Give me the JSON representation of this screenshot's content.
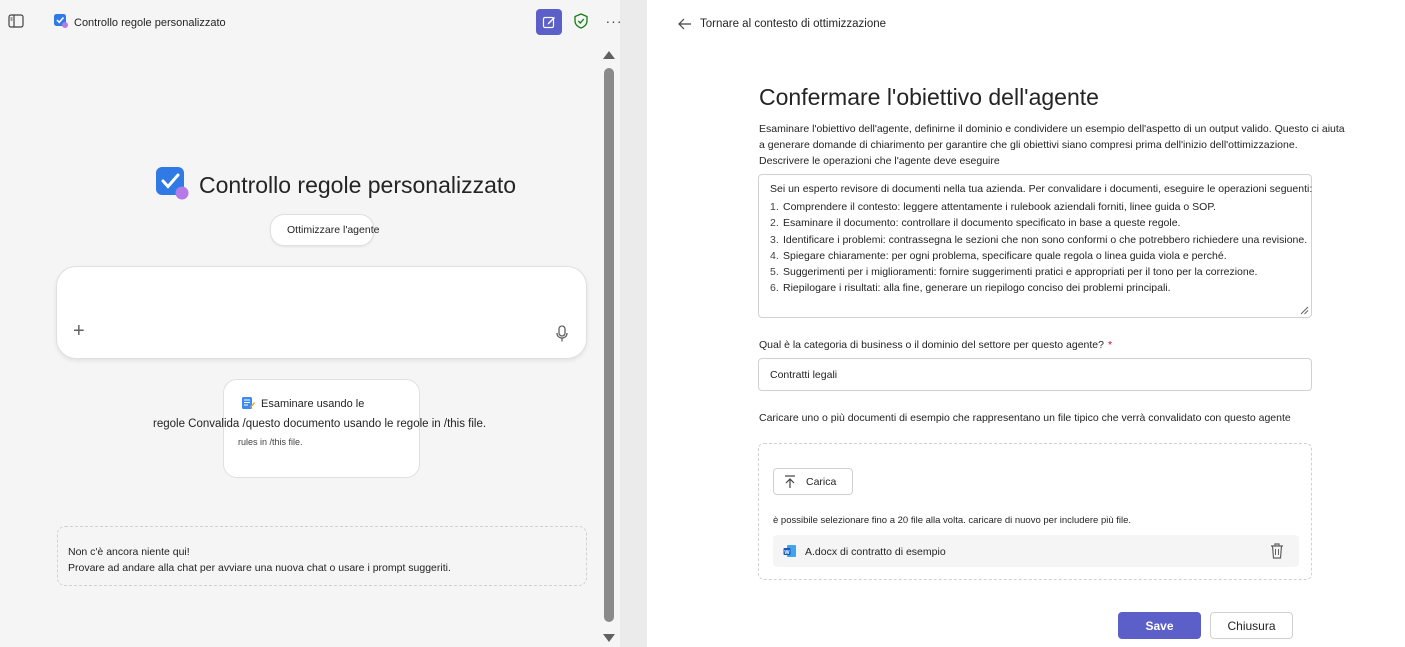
{
  "header": {
    "app_title": "Controllo regole personalizzato"
  },
  "hero": {
    "title": "Controllo regole personalizzato",
    "optimize_label": "Ottimizzare l'agente"
  },
  "prompt_card": {
    "title": "Esaminare usando le",
    "overflow_text": "regole Convalida /questo documento usando le regole in /this file.",
    "sub_text": "rules in /this file."
  },
  "empty_state": {
    "line1": "Non c'è ancora niente qui!",
    "line2": "Provare ad andare alla chat per avviare una nuova chat o usare i prompt suggeriti."
  },
  "right_panel": {
    "back_label": "Tornare al contesto di ottimizzazione",
    "title": "Confermare l'obiettivo dell'agente",
    "description": "Esaminare l'obiettivo dell'agente, definirne il dominio e condividere un esempio dell'aspetto di un output valido. Questo ci aiuta a generare domande di chiarimento per garantire che gli obiettivi siano compresi prima dell'inizio dell'ottimizzazione.",
    "instructions_label": "Descrivere le operazioni che l'agente deve eseguire",
    "instructions": {
      "intro": "Sei un esperto revisore di documenti nella tua azienda. Per convalidare i documenti, eseguire le operazioni seguenti:",
      "steps": [
        {
          "num": "1.",
          "text": "Comprendere il contesto: leggere attentamente i rulebook aziendali forniti, linee guida o SOP."
        },
        {
          "num": "2.",
          "text": "Esaminare il documento: controllare il documento specificato in base a queste regole."
        },
        {
          "num": "3.",
          "text": "Identificare i problemi: contrassegna le sezioni che non sono conformi o che potrebbero richiedere una revisione."
        },
        {
          "num": "4.",
          "text": "Spiegare chiaramente: per ogni problema, specificare quale regola o linea guida viola e perché."
        },
        {
          "num": "5.",
          "text": "Suggerimenti per i miglioramenti: fornire suggerimenti pratici e appropriati per il tono per la correzione."
        },
        {
          "num": "6.",
          "text": "Riepilogare i risultati: alla fine, generare un riepilogo conciso dei problemi principali."
        }
      ]
    },
    "domain_label": "Qual è la categoria di business o il dominio del settore per questo agente?",
    "domain_required": "*",
    "domain_value": "Contratti legali",
    "upload_label": "Caricare uno o più documenti di esempio che rappresentano un file tipico che verrà convalidato con questo agente",
    "upload_button": "Carica",
    "upload_hint": "è possibile selezionare fino a 20 file alla volta. caricare di nuovo per includere più file.",
    "file_name": "A.docx di contratto di esempio",
    "save_label": "Save",
    "close_label": "Chiusura"
  },
  "colors": {
    "accent": "#5b5fc7",
    "required": "#c50f1f",
    "shield": "#107c10"
  },
  "icons": [
    "sidebar-toggle-icon",
    "agent-app-icon",
    "edit-icon",
    "shield-check-icon",
    "more-icon",
    "sliders-icon",
    "plus-icon",
    "mic-icon",
    "notepad-icon",
    "arrow-left-icon",
    "upload-icon",
    "word-file-icon",
    "trash-icon"
  ]
}
